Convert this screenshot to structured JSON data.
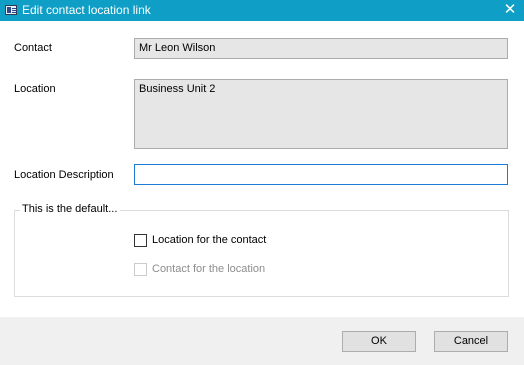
{
  "window": {
    "title": "Edit contact location link",
    "icon": "table-form-icon",
    "close_glyph": "✕"
  },
  "form": {
    "contact": {
      "label": "Contact",
      "value": "Mr Leon Wilson"
    },
    "location": {
      "label": "Location",
      "value": "Business Unit 2"
    },
    "location_description": {
      "label": "Location Description",
      "value": ""
    }
  },
  "defaults_group": {
    "legend": "This is the default...",
    "location_for_contact": {
      "label": "Location for the contact",
      "checked": false,
      "enabled": true
    },
    "contact_for_location": {
      "label": "Contact for the location",
      "checked": false,
      "enabled": false
    }
  },
  "footer": {
    "ok_label": "OK",
    "cancel_label": "Cancel"
  },
  "colors": {
    "titlebar": "#0f9fc6",
    "readonly_field": "#e6e6e6",
    "focus_border": "#1c7bd3",
    "footer": "#f0f0f0"
  }
}
